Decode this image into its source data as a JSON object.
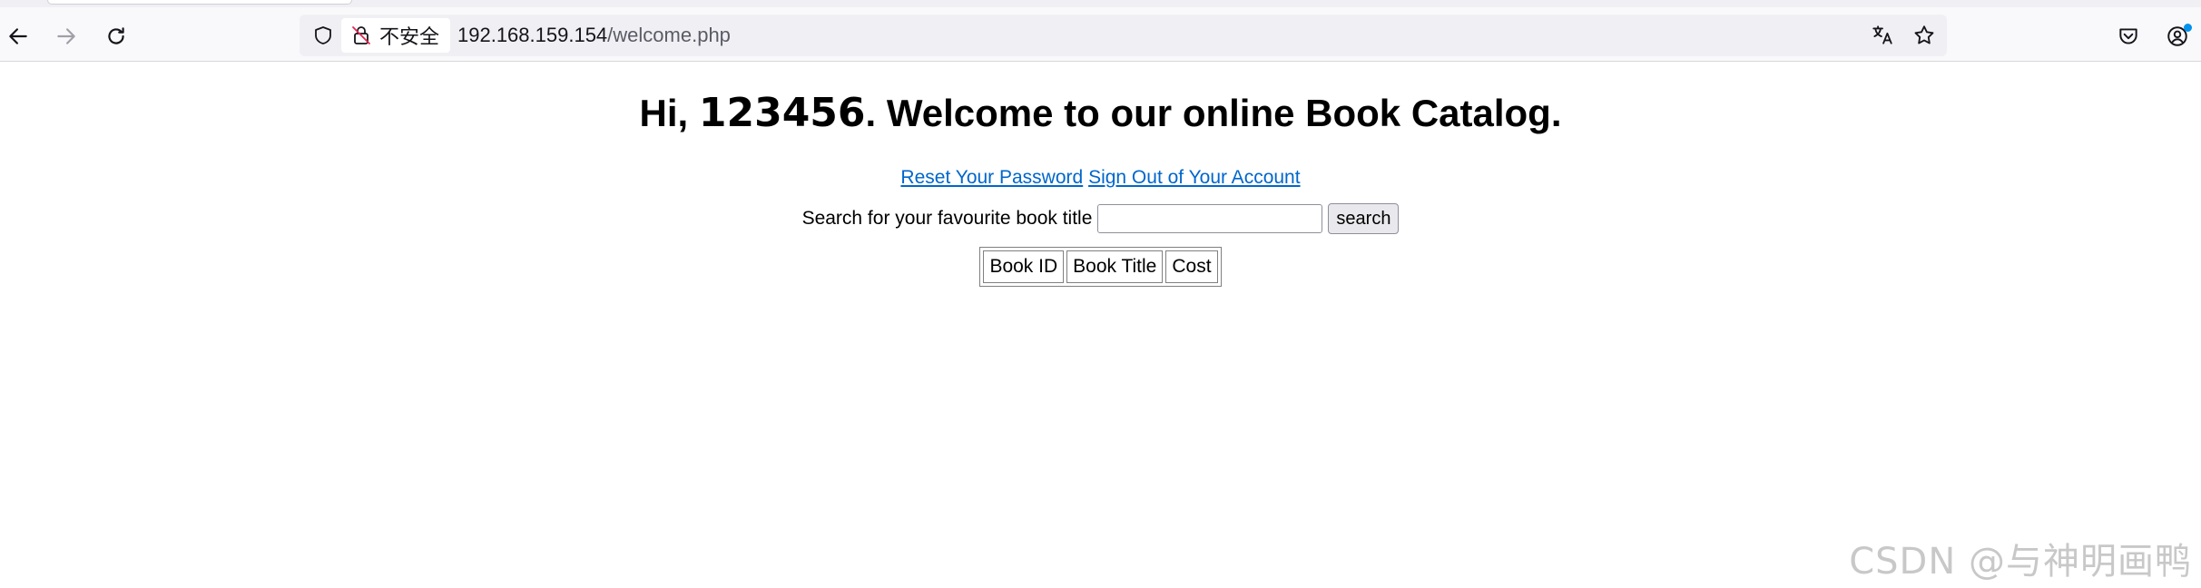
{
  "browser": {
    "security_label": "不安全",
    "url_host": "192.168.159.154",
    "url_path": "/welcome.php",
    "icons": {
      "back": "back-arrow-icon",
      "forward": "forward-arrow-icon",
      "reload": "reload-icon",
      "tracking": "shield-icon",
      "insecure": "insecure-lock-icon",
      "translate": "translate-icon",
      "bookmark": "star-icon",
      "pocket": "pocket-icon",
      "account": "account-icon"
    }
  },
  "page": {
    "greeting_prefix": "Hi, ",
    "username": "123456",
    "greeting_suffix": ". Welcome to our online Book Catalog.",
    "links": {
      "reset_password": "Reset Your Password",
      "sign_out": "Sign Out of Your Account"
    },
    "search": {
      "label": "Search for your favourite book title",
      "value": "",
      "button_label": "search"
    },
    "table": {
      "headers": [
        "Book ID",
        "Book Title",
        "Cost"
      ]
    }
  },
  "watermark": "CSDN @与神明画鸭"
}
